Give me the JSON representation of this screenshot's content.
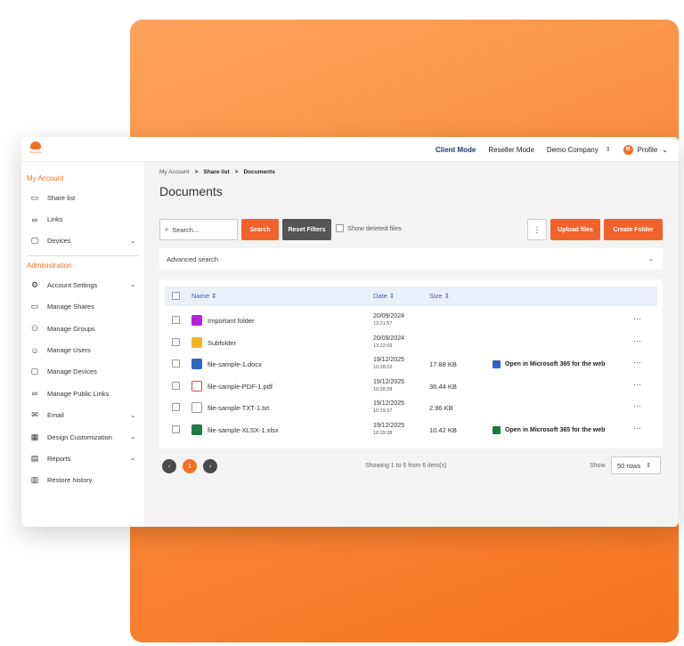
{
  "brand": {
    "logo_text": "ShareFile"
  },
  "topbar": {
    "client_mode": "Client Mode",
    "reseller_mode": "Reseller Mode",
    "company": "Demo Company",
    "avatar_initial": "M",
    "profile": "Profile"
  },
  "sidebar": {
    "my_account_title": "My Account",
    "my_account_items": [
      {
        "label": "Share list",
        "icon": "folder-icon"
      },
      {
        "label": "Links",
        "icon": "link-icon"
      },
      {
        "label": "Devices",
        "icon": "monitor-icon"
      }
    ],
    "admin_title": "Administration",
    "admin_items": [
      {
        "label": "Account Settings",
        "icon": "gear-icon"
      },
      {
        "label": "Manage Shares",
        "icon": "folder-icon"
      },
      {
        "label": "Manage Groups",
        "icon": "group-icon"
      },
      {
        "label": "Manage Users",
        "icon": "user-icon"
      },
      {
        "label": "Manage Devices",
        "icon": "monitor-icon"
      },
      {
        "label": "Manage Public Links",
        "icon": "link-icon"
      },
      {
        "label": "Email",
        "icon": "mail-icon"
      },
      {
        "label": "Design Customization",
        "icon": "palette-icon"
      },
      {
        "label": "Reports",
        "icon": "report-icon"
      },
      {
        "label": "Restore history",
        "icon": "trash-icon"
      }
    ]
  },
  "breadcrumb": {
    "root": "My Account",
    "sep": ">",
    "mid": "Share list",
    "current": "Documents"
  },
  "page_title": "Documents",
  "toolbar": {
    "search_placeholder": "Search...",
    "search_btn": "Search",
    "reset_btn": "Reset Filters",
    "show_deleted": "Show deleted files",
    "kebab": "⋮",
    "upload_btn": "Upload files",
    "create_btn": "Create Folder"
  },
  "advanced_search": "Advanced search",
  "table": {
    "headers": {
      "name": "Name",
      "date": "Date",
      "size": "Size"
    },
    "rows": [
      {
        "name": "Important folder",
        "date": "20/09/2024",
        "time": "13:21:57",
        "size": "",
        "open": "",
        "icon": "folder-purple-icon"
      },
      {
        "name": "Subfolder",
        "date": "20/09/2024",
        "time": "13:22:09",
        "size": "",
        "open": "",
        "icon": "folder-yellow-icon"
      },
      {
        "name": "file-sample-1.docx",
        "date": "19/12/2025",
        "time": "10:28:22",
        "size": "17.88 KB",
        "open": "Open in Microsoft 365 for the web",
        "icon": "word-file-icon"
      },
      {
        "name": "file-sample-PDF-1.pdf",
        "date": "19/12/2025",
        "time": "10:28:28",
        "size": "36.44 KB",
        "open": "",
        "icon": "pdf-file-icon"
      },
      {
        "name": "file-sample-TXT-1.txt",
        "date": "19/12/2025",
        "time": "10:29:37",
        "size": "2.96 KB",
        "open": "",
        "icon": "txt-file-icon"
      },
      {
        "name": "file-sample-XLSX-1.xlsx",
        "date": "19/12/2025",
        "time": "10:29:38",
        "size": "10.42 KB",
        "open": "Open in Microsoft 365 for the web",
        "icon": "excel-file-icon"
      }
    ],
    "more": "···"
  },
  "pager": {
    "prev": "‹",
    "current": "1",
    "next": "›"
  },
  "footer": {
    "showing": "Showing 1 to 6 from 6 item(s)",
    "show": "Show",
    "rows": "50 rows"
  },
  "colors": {
    "accent": "#f27022",
    "header_blue": "#3b5eab"
  }
}
